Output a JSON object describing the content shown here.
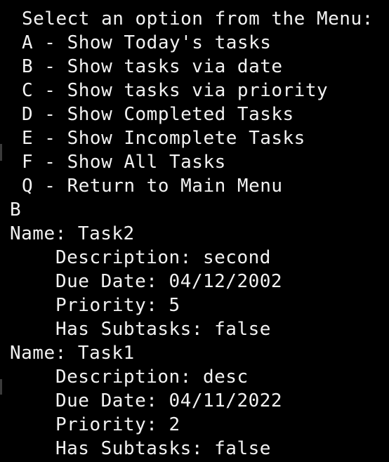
{
  "terminal": {
    "menu": {
      "prompt": "Select an option from the Menu:",
      "options": [
        "A - Show Today's tasks",
        "B - Show tasks via date",
        "C - Show tasks via priority",
        "D - Show Completed Tasks",
        "E - Show Incomplete Tasks",
        "F - Show All Tasks",
        "Q - Return to Main Menu"
      ]
    },
    "user_input": "B",
    "tasks": [
      {
        "name": "Name: Task2",
        "description": "Description: second",
        "due_date": "Due Date: 04/12/2002",
        "priority": "Priority: 5",
        "has_subtasks": "Has Subtasks: false"
      },
      {
        "name": "Name: Task1",
        "description": "Description: desc",
        "due_date": "Due Date: 04/11/2022",
        "priority": "Priority: 2",
        "has_subtasks": "Has Subtasks: false"
      }
    ],
    "colors": {
      "background": "#000000",
      "text": "#f2f2f2"
    }
  }
}
